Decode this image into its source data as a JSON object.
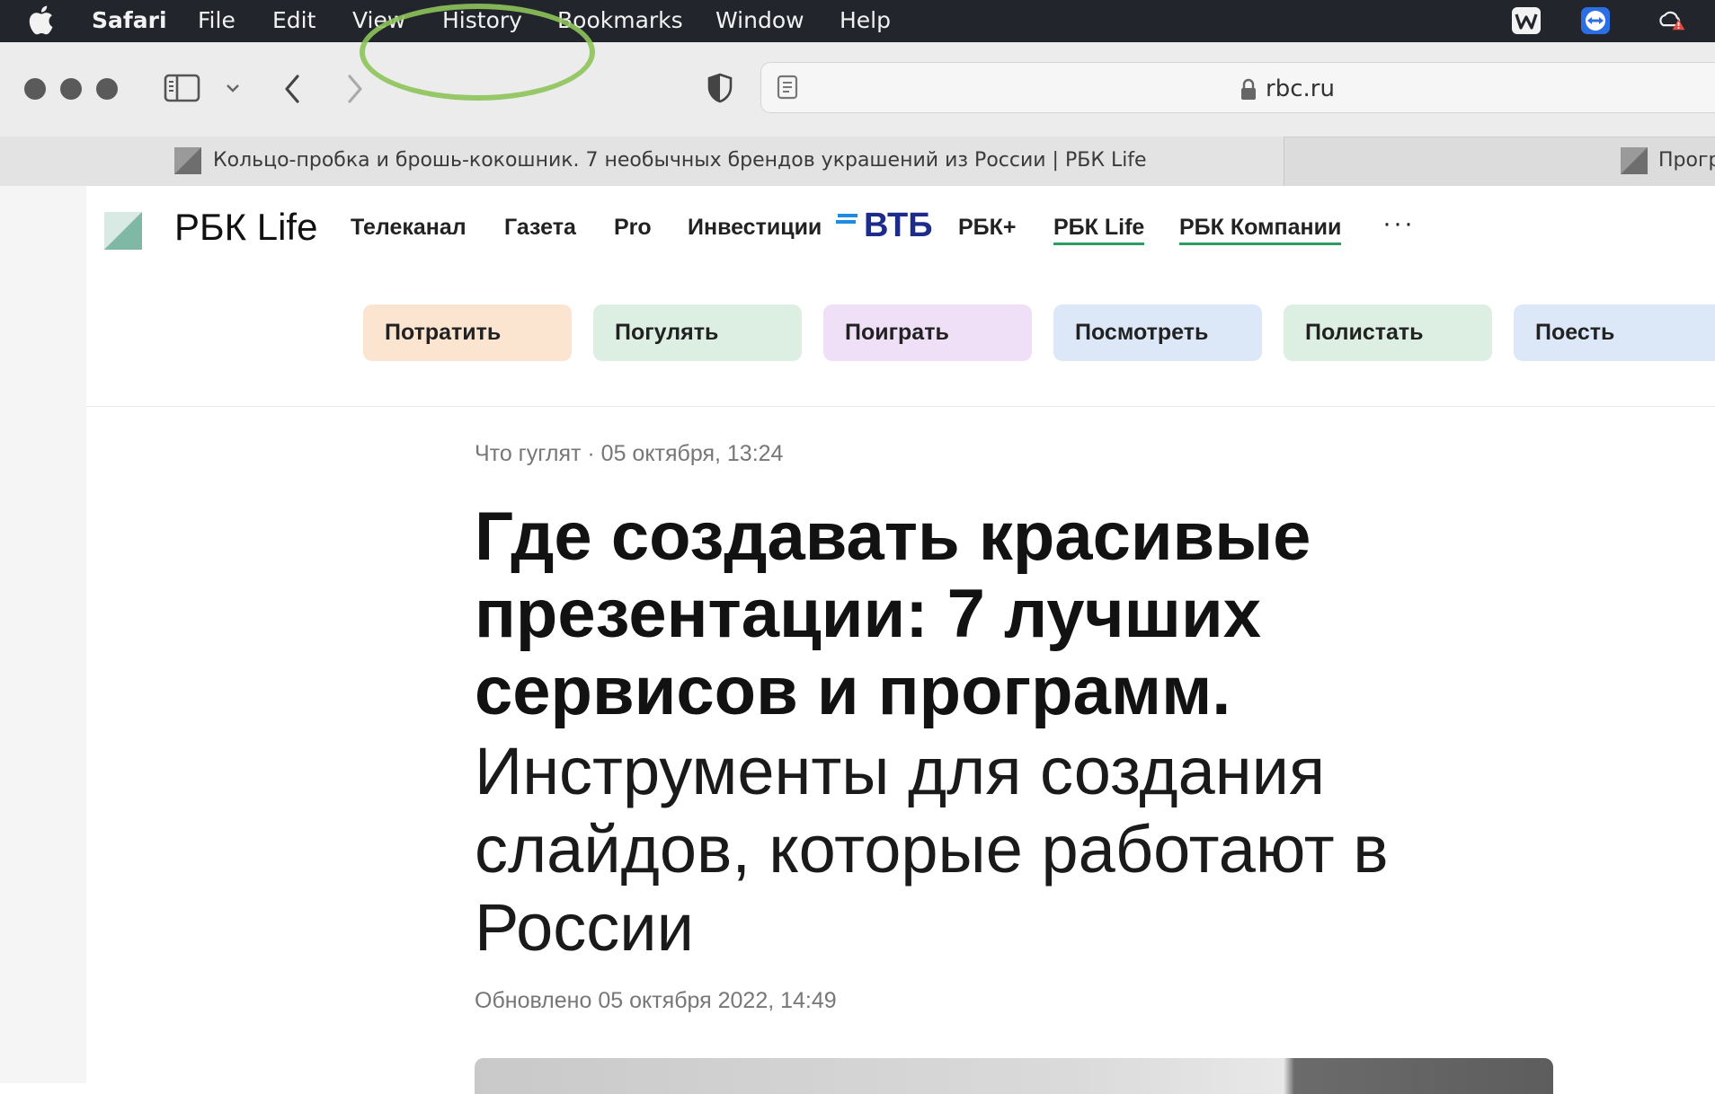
{
  "menubar": {
    "items": [
      "Safari",
      "File",
      "Edit",
      "View",
      "History",
      "Bookmarks",
      "Window",
      "Help"
    ]
  },
  "toolbar": {
    "url": "rbc.ru"
  },
  "tabs": [
    {
      "title": "Кольцо-пробка и брошь-кокошник. 7 необычных брендов украшений из России | РБК Life"
    },
    {
      "title": "Прогр"
    }
  ],
  "site": {
    "logo_text": "РБК Life",
    "nav": [
      "Телеканал",
      "Газета",
      "Pro",
      "Инвестиции",
      "РБК+",
      "РБК Life",
      "РБК Компании"
    ],
    "vtb": "ВТБ",
    "more": "···",
    "categories": [
      {
        "label": "Потратить",
        "color": "#fbe5d1"
      },
      {
        "label": "Погулять",
        "color": "#dcefe2"
      },
      {
        "label": "Поиграть",
        "color": "#efdff7"
      },
      {
        "label": "Посмотреть",
        "color": "#dce8f7"
      },
      {
        "label": "Полистать",
        "color": "#dcefe2"
      },
      {
        "label": "Поесть",
        "color": "#dce8f7"
      }
    ]
  },
  "article": {
    "meta": "Что гуглят · 05 октября, 13:24",
    "title_bold": "Где создавать красивые презентации: 7 лучших сервисов и программ.",
    "title_light": "Инструменты для создания слайдов, которые работают в России",
    "updated": "Обновлено 05 октября 2022, 14:49"
  }
}
